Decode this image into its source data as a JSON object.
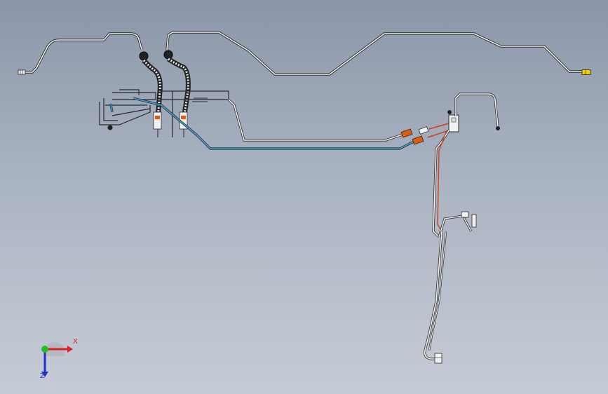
{
  "axes": {
    "x_label": "X",
    "z_label": "Z",
    "x_color": "#e02020",
    "y_color": "#20c020",
    "z_color": "#2030d0"
  },
  "colors": {
    "background_top": "#8a96a8",
    "background_bottom": "#c6ccd6",
    "tube": "#f2f2f2",
    "tube_outline": "#2a2a2a",
    "brake_line_blue": "#3aa8d8",
    "brake_line_red": "#d04020",
    "fitting_orange": "#e05a10",
    "fitting_yellow": "#f0d000",
    "hose_dark": "#222222"
  }
}
